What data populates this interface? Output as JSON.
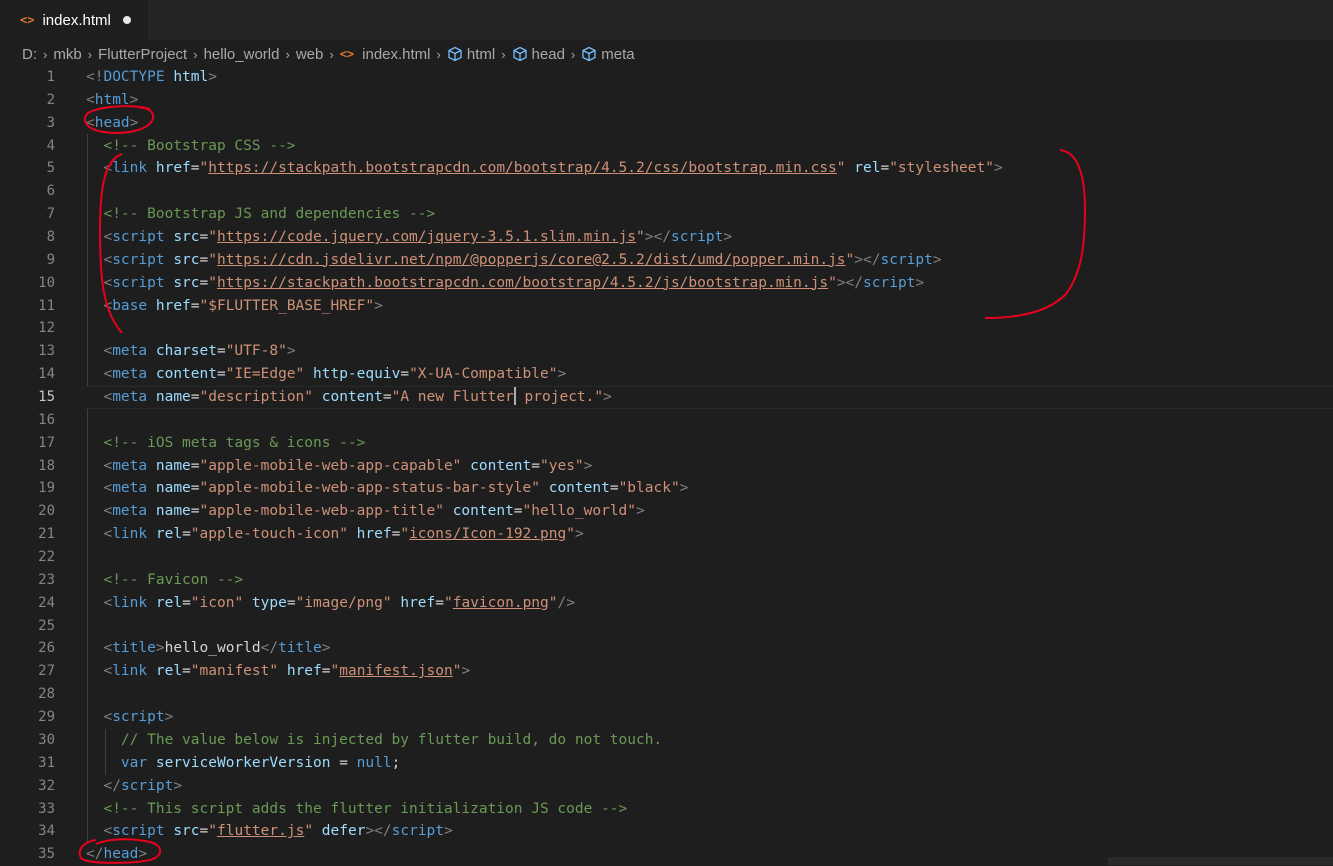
{
  "tab": {
    "icon": "<>",
    "label": "index.html"
  },
  "breadcrumb": {
    "items": [
      "D:",
      "mkb",
      "FlutterProject",
      "hello_world",
      "web",
      "index.html",
      "html",
      "head",
      "meta"
    ],
    "file_icon": "<>"
  },
  "editor": {
    "active_line": 15,
    "line_numbers": [
      "1",
      "2",
      "3",
      "4",
      "5",
      "6",
      "7",
      "8",
      "9",
      "10",
      "11",
      "12",
      "13",
      "14",
      "15",
      "16",
      "17",
      "18",
      "19",
      "20",
      "21",
      "22",
      "23",
      "24",
      "25",
      "26",
      "27",
      "28",
      "29",
      "30",
      "31",
      "32",
      "33",
      "34",
      "35"
    ],
    "lines": [
      [
        [
          "p",
          "<!"
        ],
        [
          "t",
          "DOCTYPE"
        ],
        [
          "w",
          " "
        ],
        [
          "a",
          "html"
        ],
        [
          "p",
          ">"
        ]
      ],
      [
        [
          "p",
          "<"
        ],
        [
          "t",
          "html"
        ],
        [
          "p",
          ">"
        ]
      ],
      [
        [
          "p",
          "<"
        ],
        [
          "t",
          "head"
        ],
        [
          "p",
          ">"
        ]
      ],
      [
        [
          "w",
          "  "
        ],
        [
          "c",
          "<!-- Bootstrap CSS -->"
        ]
      ],
      [
        [
          "w",
          "  "
        ],
        [
          "p",
          "<"
        ],
        [
          "t",
          "link"
        ],
        [
          "w",
          " "
        ],
        [
          "a",
          "href"
        ],
        [
          "w",
          "="
        ],
        [
          "s",
          "\""
        ],
        [
          "u",
          "https://stackpath.bootstrapcdn.com/bootstrap/4.5.2/css/bootstrap.min.css"
        ],
        [
          "s",
          "\""
        ],
        [
          "w",
          " "
        ],
        [
          "a",
          "rel"
        ],
        [
          "w",
          "="
        ],
        [
          "s",
          "\"stylesheet\""
        ],
        [
          "p",
          ">"
        ]
      ],
      [],
      [
        [
          "w",
          "  "
        ],
        [
          "c",
          "<!-- Bootstrap JS and dependencies -->"
        ]
      ],
      [
        [
          "w",
          "  "
        ],
        [
          "p",
          "<"
        ],
        [
          "t",
          "script"
        ],
        [
          "w",
          " "
        ],
        [
          "a",
          "src"
        ],
        [
          "w",
          "="
        ],
        [
          "s",
          "\""
        ],
        [
          "u",
          "https://code.jquery.com/jquery-3.5.1.slim.min.js"
        ],
        [
          "s",
          "\""
        ],
        [
          "p",
          "></"
        ],
        [
          "t",
          "script"
        ],
        [
          "p",
          ">"
        ]
      ],
      [
        [
          "w",
          "  "
        ],
        [
          "p",
          "<"
        ],
        [
          "t",
          "script"
        ],
        [
          "w",
          " "
        ],
        [
          "a",
          "src"
        ],
        [
          "w",
          "="
        ],
        [
          "s",
          "\""
        ],
        [
          "u",
          "https://cdn.jsdelivr.net/npm/@popperjs/core@2.5.2/dist/umd/popper.min.js"
        ],
        [
          "s",
          "\""
        ],
        [
          "p",
          "></"
        ],
        [
          "t",
          "script"
        ],
        [
          "p",
          ">"
        ]
      ],
      [
        [
          "w",
          "  "
        ],
        [
          "p",
          "<"
        ],
        [
          "t",
          "script"
        ],
        [
          "w",
          " "
        ],
        [
          "a",
          "src"
        ],
        [
          "w",
          "="
        ],
        [
          "s",
          "\""
        ],
        [
          "u",
          "https://stackpath.bootstrapcdn.com/bootstrap/4.5.2/js/bootstrap.min.js"
        ],
        [
          "s",
          "\""
        ],
        [
          "p",
          "></"
        ],
        [
          "t",
          "script"
        ],
        [
          "p",
          ">"
        ]
      ],
      [
        [
          "w",
          "  "
        ],
        [
          "p",
          "<"
        ],
        [
          "t",
          "base"
        ],
        [
          "w",
          " "
        ],
        [
          "a",
          "href"
        ],
        [
          "w",
          "="
        ],
        [
          "s",
          "\"$FLUTTER_BASE_HREF\""
        ],
        [
          "p",
          ">"
        ]
      ],
      [],
      [
        [
          "w",
          "  "
        ],
        [
          "p",
          "<"
        ],
        [
          "t",
          "meta"
        ],
        [
          "w",
          " "
        ],
        [
          "a",
          "charset"
        ],
        [
          "w",
          "="
        ],
        [
          "s",
          "\"UTF-8\""
        ],
        [
          "p",
          ">"
        ]
      ],
      [
        [
          "w",
          "  "
        ],
        [
          "p",
          "<"
        ],
        [
          "t",
          "meta"
        ],
        [
          "w",
          " "
        ],
        [
          "a",
          "content"
        ],
        [
          "w",
          "="
        ],
        [
          "s",
          "\"IE=Edge\""
        ],
        [
          "w",
          " "
        ],
        [
          "a",
          "http-equiv"
        ],
        [
          "w",
          "="
        ],
        [
          "s",
          "\"X-UA-Compatible\""
        ],
        [
          "p",
          ">"
        ]
      ],
      [
        [
          "w",
          "  "
        ],
        [
          "p",
          "<"
        ],
        [
          "t",
          "meta"
        ],
        [
          "w",
          " "
        ],
        [
          "a",
          "name"
        ],
        [
          "w",
          "="
        ],
        [
          "s",
          "\"description\""
        ],
        [
          "w",
          " "
        ],
        [
          "a",
          "content"
        ],
        [
          "w",
          "="
        ],
        [
          "s",
          "\"A new Flutter"
        ],
        [
          "cursor",
          ""
        ],
        [
          "s",
          " project.\""
        ],
        [
          "p",
          ">"
        ]
      ],
      [],
      [
        [
          "w",
          "  "
        ],
        [
          "c",
          "<!-- iOS meta tags & icons -->"
        ]
      ],
      [
        [
          "w",
          "  "
        ],
        [
          "p",
          "<"
        ],
        [
          "t",
          "meta"
        ],
        [
          "w",
          " "
        ],
        [
          "a",
          "name"
        ],
        [
          "w",
          "="
        ],
        [
          "s",
          "\"apple-mobile-web-app-capable\""
        ],
        [
          "w",
          " "
        ],
        [
          "a",
          "content"
        ],
        [
          "w",
          "="
        ],
        [
          "s",
          "\"yes\""
        ],
        [
          "p",
          ">"
        ]
      ],
      [
        [
          "w",
          "  "
        ],
        [
          "p",
          "<"
        ],
        [
          "t",
          "meta"
        ],
        [
          "w",
          " "
        ],
        [
          "a",
          "name"
        ],
        [
          "w",
          "="
        ],
        [
          "s",
          "\"apple-mobile-web-app-status-bar-style\""
        ],
        [
          "w",
          " "
        ],
        [
          "a",
          "content"
        ],
        [
          "w",
          "="
        ],
        [
          "s",
          "\"black\""
        ],
        [
          "p",
          ">"
        ]
      ],
      [
        [
          "w",
          "  "
        ],
        [
          "p",
          "<"
        ],
        [
          "t",
          "meta"
        ],
        [
          "w",
          " "
        ],
        [
          "a",
          "name"
        ],
        [
          "w",
          "="
        ],
        [
          "s",
          "\"apple-mobile-web-app-title\""
        ],
        [
          "w",
          " "
        ],
        [
          "a",
          "content"
        ],
        [
          "w",
          "="
        ],
        [
          "s",
          "\"hello_world\""
        ],
        [
          "p",
          ">"
        ]
      ],
      [
        [
          "w",
          "  "
        ],
        [
          "p",
          "<"
        ],
        [
          "t",
          "link"
        ],
        [
          "w",
          " "
        ],
        [
          "a",
          "rel"
        ],
        [
          "w",
          "="
        ],
        [
          "s",
          "\"apple-touch-icon\""
        ],
        [
          "w",
          " "
        ],
        [
          "a",
          "href"
        ],
        [
          "w",
          "="
        ],
        [
          "s",
          "\""
        ],
        [
          "u",
          "icons/Icon-192.png"
        ],
        [
          "s",
          "\""
        ],
        [
          "p",
          ">"
        ]
      ],
      [],
      [
        [
          "w",
          "  "
        ],
        [
          "c",
          "<!-- Favicon -->"
        ]
      ],
      [
        [
          "w",
          "  "
        ],
        [
          "p",
          "<"
        ],
        [
          "t",
          "link"
        ],
        [
          "w",
          " "
        ],
        [
          "a",
          "rel"
        ],
        [
          "w",
          "="
        ],
        [
          "s",
          "\"icon\""
        ],
        [
          "w",
          " "
        ],
        [
          "a",
          "type"
        ],
        [
          "w",
          "="
        ],
        [
          "s",
          "\"image/png\""
        ],
        [
          "w",
          " "
        ],
        [
          "a",
          "href"
        ],
        [
          "w",
          "="
        ],
        [
          "s",
          "\""
        ],
        [
          "u",
          "favicon.png"
        ],
        [
          "s",
          "\""
        ],
        [
          "p",
          "/>"
        ]
      ],
      [],
      [
        [
          "w",
          "  "
        ],
        [
          "p",
          "<"
        ],
        [
          "t",
          "title"
        ],
        [
          "p",
          ">"
        ],
        [
          "w",
          "hello_world"
        ],
        [
          "p",
          "</"
        ],
        [
          "t",
          "title"
        ],
        [
          "p",
          ">"
        ]
      ],
      [
        [
          "w",
          "  "
        ],
        [
          "p",
          "<"
        ],
        [
          "t",
          "link"
        ],
        [
          "w",
          " "
        ],
        [
          "a",
          "rel"
        ],
        [
          "w",
          "="
        ],
        [
          "s",
          "\"manifest\""
        ],
        [
          "w",
          " "
        ],
        [
          "a",
          "href"
        ],
        [
          "w",
          "="
        ],
        [
          "s",
          "\""
        ],
        [
          "u",
          "manifest.json"
        ],
        [
          "s",
          "\""
        ],
        [
          "p",
          ">"
        ]
      ],
      [],
      [
        [
          "w",
          "  "
        ],
        [
          "p",
          "<"
        ],
        [
          "t",
          "script"
        ],
        [
          "p",
          ">"
        ]
      ],
      [
        [
          "w",
          "    "
        ],
        [
          "c",
          "// The value below is injected by flutter build, do not touch."
        ]
      ],
      [
        [
          "w",
          "    "
        ],
        [
          "k",
          "var"
        ],
        [
          "w",
          " "
        ],
        [
          "v",
          "serviceWorkerVersion"
        ],
        [
          "w",
          " = "
        ],
        [
          "k",
          "null"
        ],
        [
          "w",
          ";"
        ]
      ],
      [
        [
          "w",
          "  "
        ],
        [
          "p",
          "</"
        ],
        [
          "t",
          "script"
        ],
        [
          "p",
          ">"
        ]
      ],
      [
        [
          "w",
          "  "
        ],
        [
          "c",
          "<!-- This script adds the flutter initialization JS code -->"
        ]
      ],
      [
        [
          "w",
          "  "
        ],
        [
          "p",
          "<"
        ],
        [
          "t",
          "script"
        ],
        [
          "w",
          " "
        ],
        [
          "a",
          "src"
        ],
        [
          "w",
          "="
        ],
        [
          "s",
          "\""
        ],
        [
          "u",
          "flutter.js"
        ],
        [
          "s",
          "\""
        ],
        [
          "w",
          " "
        ],
        [
          "a",
          "defer"
        ],
        [
          "p",
          "></"
        ],
        [
          "t",
          "script"
        ],
        [
          "p",
          ">"
        ]
      ],
      [
        [
          "p",
          "</"
        ],
        [
          "t",
          "head"
        ],
        [
          "p",
          ">"
        ]
      ]
    ]
  },
  "colors": {
    "annotation": "#e8001c",
    "background": "#1e1e1e"
  }
}
